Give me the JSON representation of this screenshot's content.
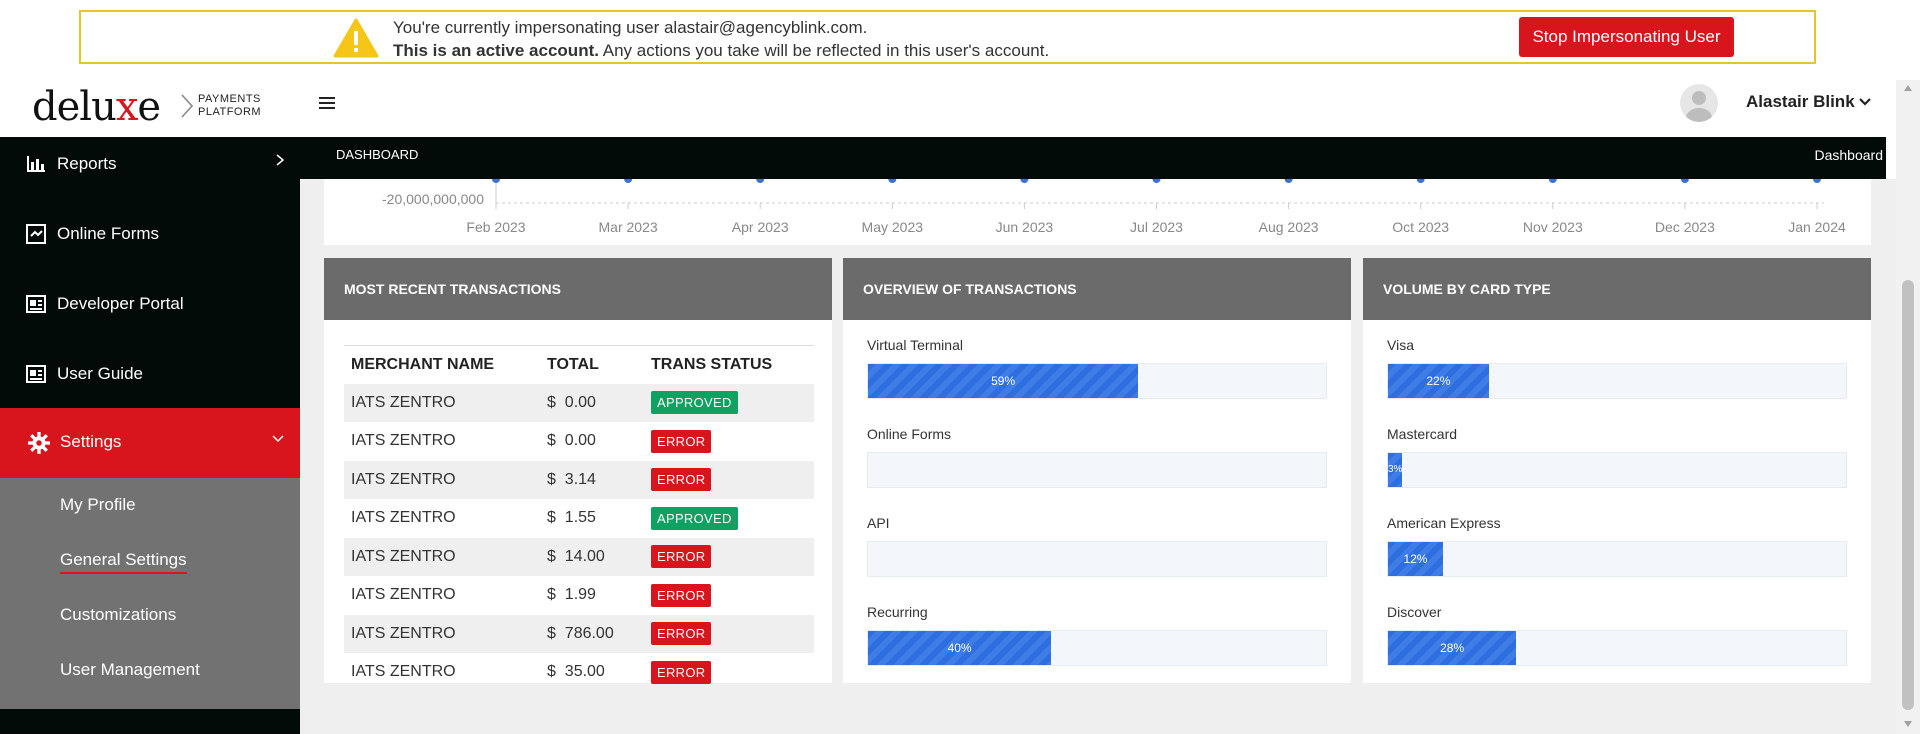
{
  "banner": {
    "line1": "You're currently impersonating user alastair@agencyblink.com.",
    "line2_bold": "This is an active account.",
    "line2_rest": " Any actions you take will be reflected in this user's account.",
    "button": "Stop Impersonating User"
  },
  "header": {
    "logo_pre": "delu",
    "logo_x": "x",
    "logo_post": "e",
    "logo_sub1": "PAYMENTS",
    "logo_sub2": "PLATFORM",
    "user_name": "Alastair Blink"
  },
  "sidebar": {
    "items": [
      {
        "label": "Reports"
      },
      {
        "label": "Online Forms"
      },
      {
        "label": "Developer Portal"
      },
      {
        "label": "User Guide"
      },
      {
        "label": "Settings"
      }
    ],
    "sub_items": [
      {
        "label": "My Profile"
      },
      {
        "label": "General Settings"
      },
      {
        "label": "Customizations"
      },
      {
        "label": "User Management"
      }
    ]
  },
  "breadcrumb": {
    "left": "DASHBOARD",
    "right": "Dashboard"
  },
  "chart_data": {
    "type": "line",
    "x": [
      "Feb 2023",
      "Mar 2023",
      "Apr 2023",
      "May 2023",
      "Jun 2023",
      "Jul 2023",
      "Aug 2023",
      "Oct 2023",
      "Nov 2023",
      "Dec 2023",
      "Jan 2024"
    ],
    "y_tick_visible": "-20,000,000,000"
  },
  "recent": {
    "title": "MOST RECENT TRANSACTIONS",
    "columns": [
      "MERCHANT NAME",
      "TOTAL",
      "TRANS STATUS"
    ],
    "rows": [
      {
        "merchant": "IATS ZENTRO",
        "total": "$  0.00",
        "status": "APPROVED"
      },
      {
        "merchant": "IATS ZENTRO",
        "total": "$  0.00",
        "status": "ERROR"
      },
      {
        "merchant": "IATS ZENTRO",
        "total": "$  3.14",
        "status": "ERROR"
      },
      {
        "merchant": "IATS ZENTRO",
        "total": "$  1.55",
        "status": "APPROVED"
      },
      {
        "merchant": "IATS ZENTRO",
        "total": "$  14.00",
        "status": "ERROR"
      },
      {
        "merchant": "IATS ZENTRO",
        "total": "$  1.99",
        "status": "ERROR"
      },
      {
        "merchant": "IATS ZENTRO",
        "total": "$  786.00",
        "status": "ERROR"
      },
      {
        "merchant": "IATS ZENTRO",
        "total": "$  35.00",
        "status": "ERROR"
      }
    ]
  },
  "overview": {
    "title": "OVERVIEW OF TRANSACTIONS",
    "bars": [
      {
        "label": "Virtual Terminal",
        "value": 59,
        "text": "59%"
      },
      {
        "label": "Online Forms",
        "value": 0,
        "text": ""
      },
      {
        "label": "API",
        "value": 0,
        "text": ""
      },
      {
        "label": "Recurring",
        "value": 40,
        "text": "40%"
      }
    ]
  },
  "cardtype": {
    "title": "VOLUME BY CARD TYPE",
    "bars": [
      {
        "label": "Visa",
        "value": 22,
        "text": "22%"
      },
      {
        "label": "Mastercard",
        "value": 3,
        "text": "3%"
      },
      {
        "label": "American Express",
        "value": 12,
        "text": "12%"
      },
      {
        "label": "Discover",
        "value": 28,
        "text": "28%"
      }
    ]
  },
  "colors": {
    "brand_red": "#d8141c",
    "approved_green": "#0ea262",
    "bar_blue": "#2e6fe0",
    "banner_border": "#e2c62b"
  }
}
